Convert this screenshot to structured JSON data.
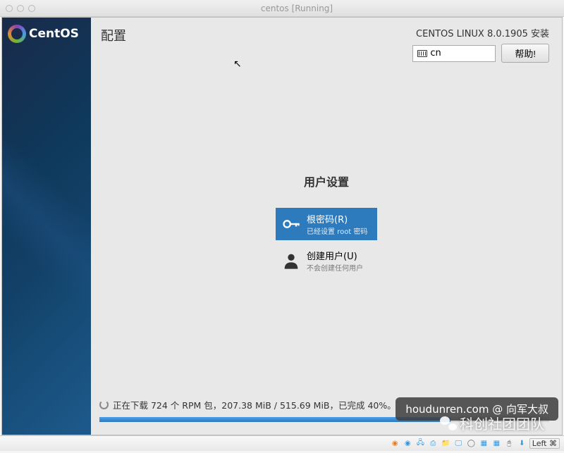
{
  "window": {
    "title": "centos [Running]"
  },
  "sidebar": {
    "brand": "CentOS"
  },
  "topbar": {
    "title": "配置",
    "version": "CENTOS LINUX 8.0.1905 安装",
    "lang": "cn",
    "help": "帮助!"
  },
  "content": {
    "heading": "用户设置",
    "root": {
      "label": "根密码(R)",
      "sub": "已经设置 root 密码"
    },
    "user": {
      "label": "创建用户(U)",
      "sub": "不会创建任何用户"
    }
  },
  "progress": {
    "text": "正在下载 724 个 RPM 包，207.38 MiB / 515.69 MiB，已完成 40%。",
    "percent": 40
  },
  "statusbar": {
    "left_text": "Left ⌘"
  },
  "watermarks": {
    "w1": "houdunren.com @ 向军大叔",
    "w2": "科创社团团队"
  }
}
